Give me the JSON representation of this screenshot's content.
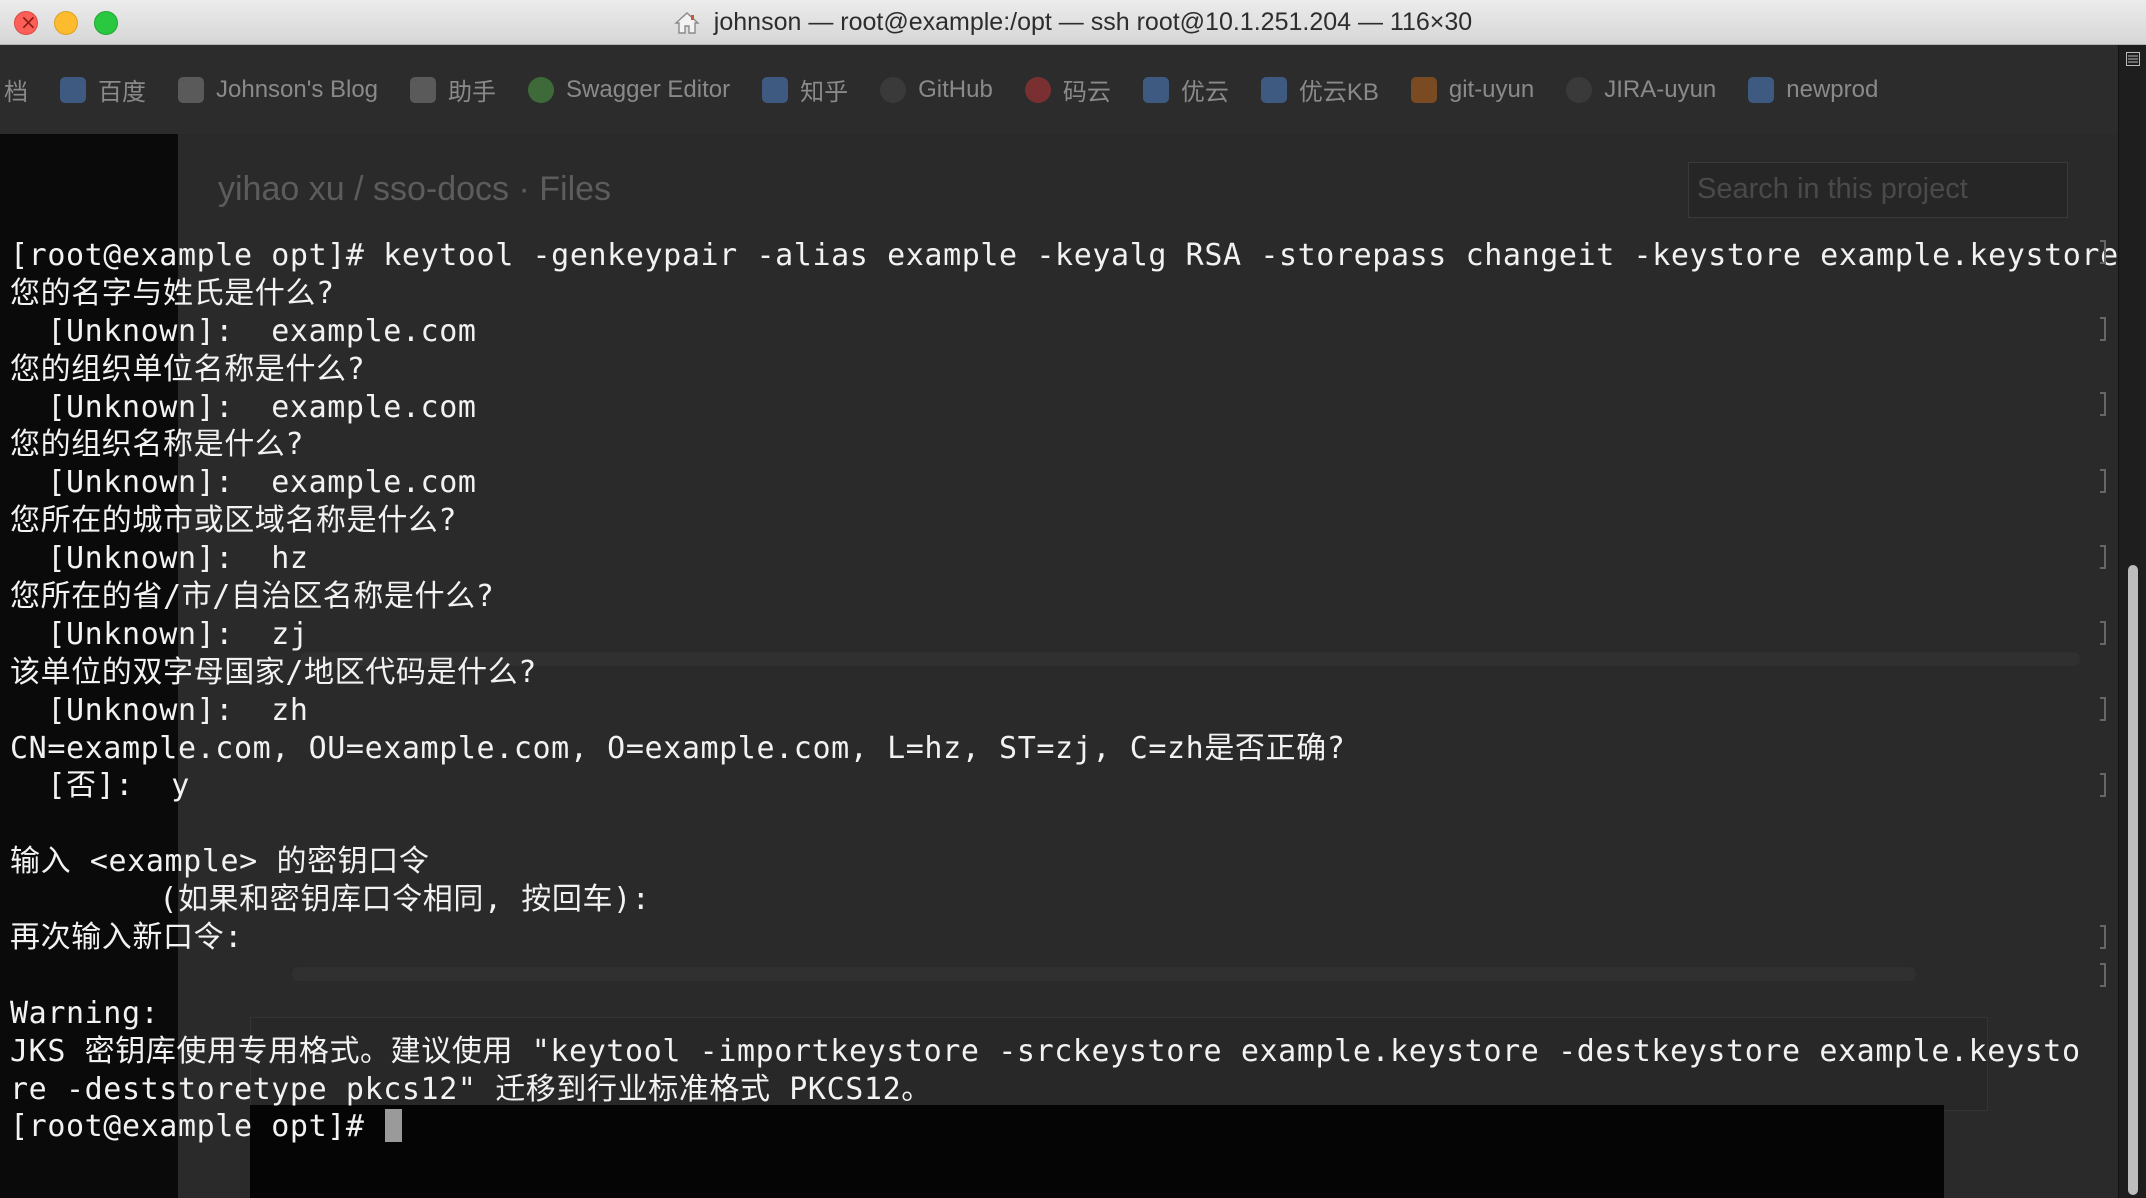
{
  "window": {
    "title": "johnson — root@example:/opt — ssh root@10.1.251.204 — 116×30"
  },
  "background_page": {
    "bookmarks": [
      {
        "label": "档",
        "icon": "none"
      },
      {
        "label": "百度",
        "icon": "baidu-icon"
      },
      {
        "label": "Johnson's Blog",
        "icon": "blog-icon"
      },
      {
        "label": "助手",
        "icon": "helper-icon"
      },
      {
        "label": "Swagger Editor",
        "icon": "swagger-icon"
      },
      {
        "label": "知乎",
        "icon": "zhihu-icon"
      },
      {
        "label": "GitHub",
        "icon": "github-icon"
      },
      {
        "label": "码云",
        "icon": "gitee-icon"
      },
      {
        "label": "优云",
        "icon": "shield-icon"
      },
      {
        "label": "优云KB",
        "icon": "confluence-icon"
      },
      {
        "label": "git-uyun",
        "icon": "gitlab-icon"
      },
      {
        "label": "JIRA-uyun",
        "icon": "jira-icon"
      },
      {
        "label": "newprod",
        "icon": "shield-icon"
      }
    ],
    "breadcrumb": "yihao xu / sso-docs · Files",
    "search_placeholder": "Search in this project"
  },
  "terminal": {
    "lines": [
      "[root@example opt]# keytool -genkeypair -alias example -keyalg RSA -storepass changeit -keystore example.keystore",
      "您的名字与姓氏是什么?",
      "  [Unknown]:  example.com",
      "您的组织单位名称是什么?",
      "  [Unknown]:  example.com",
      "您的组织名称是什么?",
      "  [Unknown]:  example.com",
      "您所在的城市或区域名称是什么?",
      "  [Unknown]:  hz",
      "您所在的省/市/自治区名称是什么?",
      "  [Unknown]:  zj",
      "该单位的双字母国家/地区代码是什么?",
      "  [Unknown]:  zh",
      "CN=example.com, OU=example.com, O=example.com, L=hz, ST=zj, C=zh是否正确?",
      "  [否]:  y",
      "",
      "输入 <example> 的密钥口令",
      "        (如果和密钥库口令相同, 按回车):",
      "再次输入新口令:",
      "",
      "Warning:",
      "JKS 密钥库使用专用格式。建议使用 \"keytool -importkeystore -srckeystore example.keystore -destkeystore example.keysto",
      "re -deststoretype pkcs12\" 迁移到行业标准格式 PKCS12。",
      "[root@example opt]# "
    ]
  }
}
